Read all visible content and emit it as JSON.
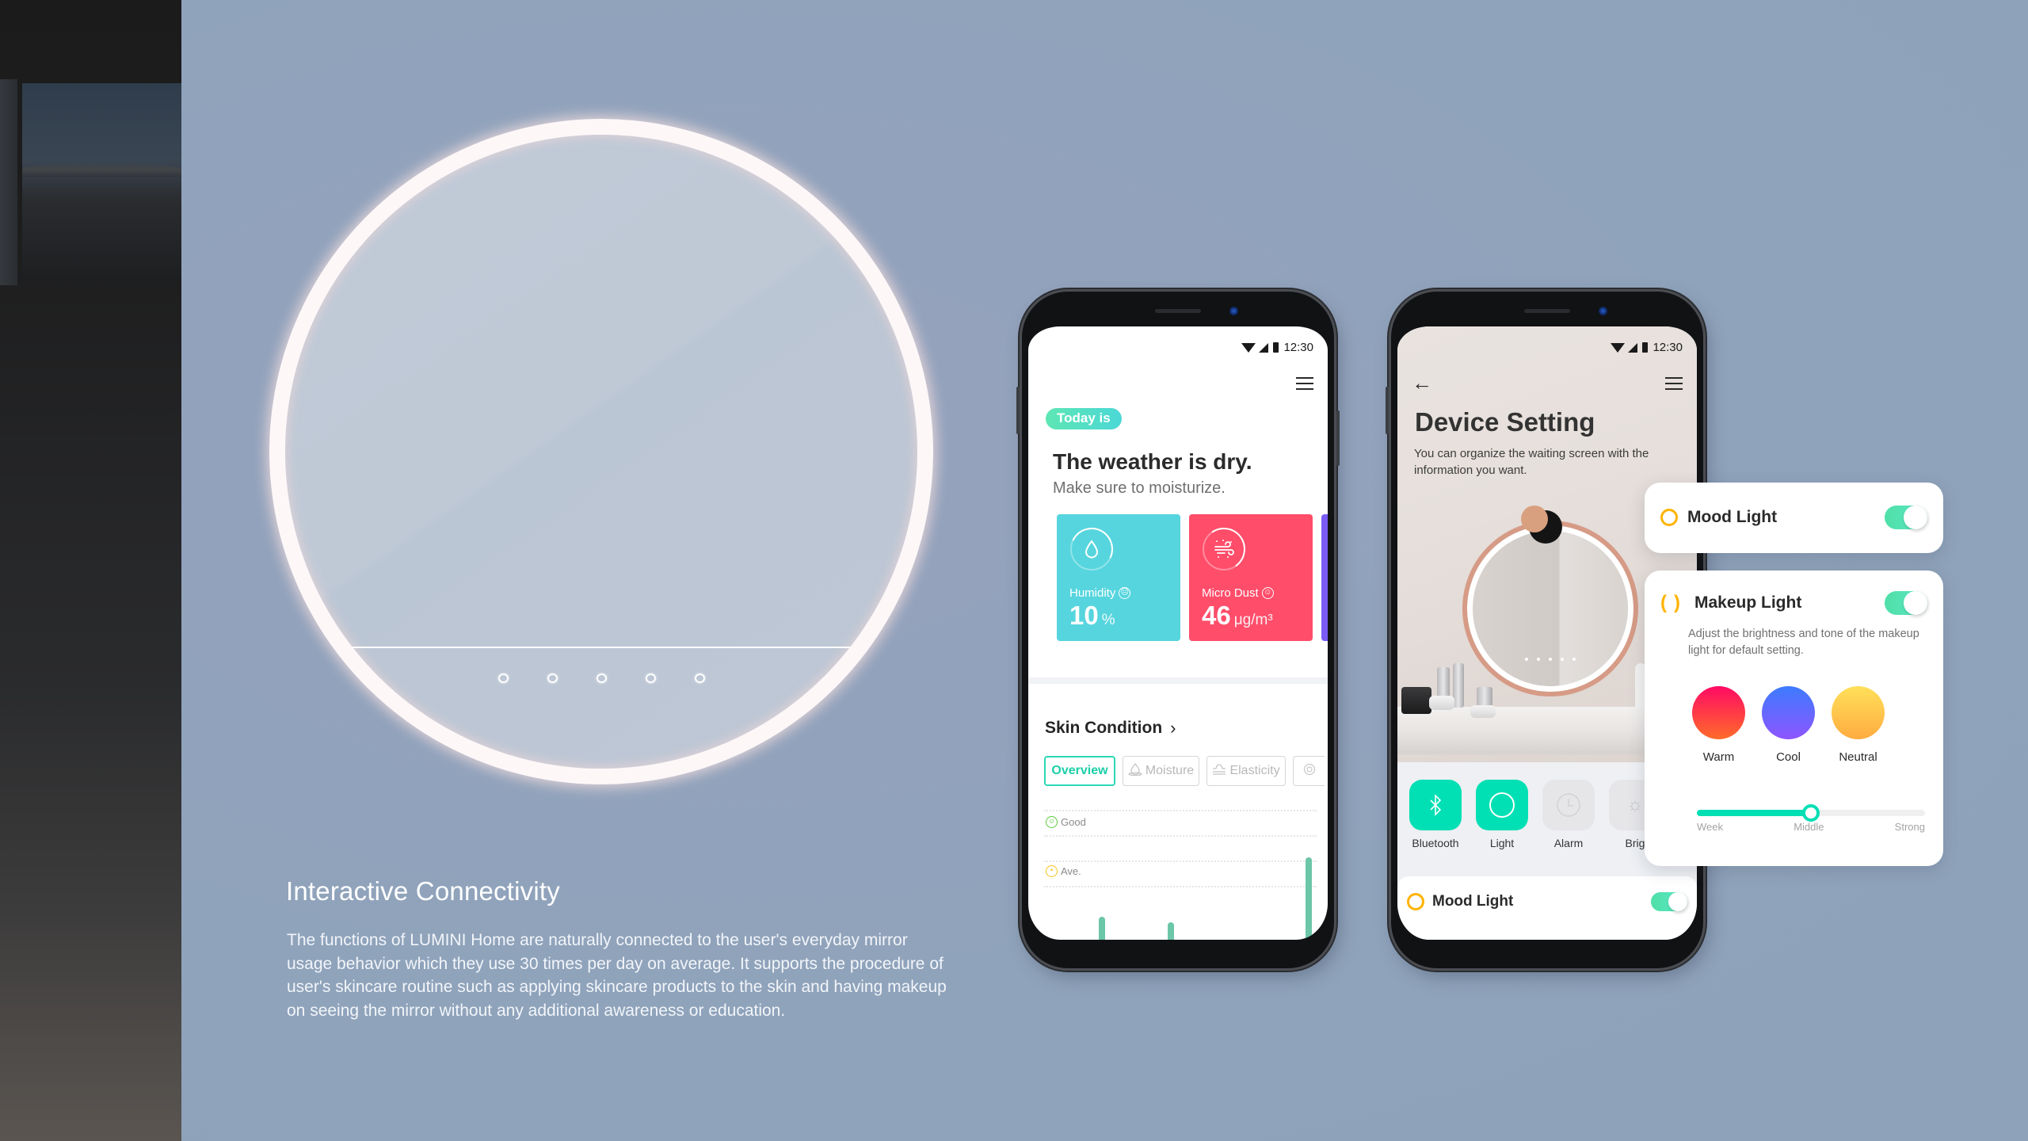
{
  "background": {
    "color": "#8fa3bb"
  },
  "intro": {
    "title": "Interactive Connectivity",
    "body": "The functions of LUMINI Home are naturally connected to the user's everyday mirror usage behavior which they use 30 times per day on average. It supports the procedure of user's skincare routine such as applying skincare products to the skin and having makeup on seeing the mirror without any additional awareness or education."
  },
  "mirror": {
    "touch_buttons": 5
  },
  "phone1": {
    "status": {
      "time": "12:30",
      "icons": [
        "wifi-icon",
        "signal-icon",
        "battery-icon"
      ]
    },
    "menu_icon": "menu-icon",
    "badge": "Today is",
    "title": "The weather is dry.",
    "subtitle": "Make sure to moisturize.",
    "tiles": [
      {
        "label": "Humidity",
        "face": "sad-face-icon",
        "value": "10",
        "unit": "%",
        "icon": "water-drop-icon",
        "color": "#56d5de"
      },
      {
        "label": "Micro Dust",
        "face": "happy-face-icon",
        "value": "46",
        "unit": "μg/m³",
        "icon": "wind-dust-icon",
        "color": "#ff4d6a"
      }
    ],
    "skin": {
      "title": "Skin Condition",
      "tabs": [
        {
          "label": "Overview",
          "active": true
        },
        {
          "label": "Moisture",
          "icon": "moisture-icon"
        },
        {
          "label": "Elasticity",
          "icon": "elasticity-icon"
        },
        {
          "label": "",
          "icon": "pore-icon"
        }
      ],
      "levels": [
        {
          "label": "Good",
          "color": "#5ccb3a"
        },
        {
          "label": "Ave.",
          "color": "#f5c518"
        }
      ]
    },
    "chart_data": {
      "type": "bar",
      "title": "Skin Condition",
      "ylabel": "",
      "xlabel": "",
      "levels": [
        "Ave.",
        "Good"
      ],
      "ylim": [
        0,
        1
      ],
      "values": [
        0.0,
        0.28,
        0.0,
        0.0,
        0.24,
        0.0,
        0.0,
        0.0,
        0.0,
        0.0,
        0.75
      ],
      "color": "#6cc6a8"
    }
  },
  "phone2": {
    "status": {
      "time": "12:30",
      "icons": [
        "wifi-icon",
        "signal-icon",
        "battery-icon"
      ]
    },
    "back_icon": "arrow-left-icon",
    "title": "Device Setting",
    "subtitle": "You can organize the waiting screen with the information you want.",
    "quick_actions": [
      {
        "label": "Bluetooth",
        "icon": "bluetooth-icon",
        "on": true
      },
      {
        "label": "Light",
        "icon": "light-ring-icon",
        "on": true
      },
      {
        "label": "Alarm",
        "icon": "clock-icon",
        "on": false
      },
      {
        "label": "Brig",
        "icon": "brightness-icon",
        "on": false
      }
    ],
    "mood_light": {
      "label": "Mood Light",
      "enabled": true
    }
  },
  "cards": {
    "mood": {
      "label": "Mood Light",
      "enabled": true
    },
    "makeup": {
      "label": "Makeup Light",
      "enabled": true,
      "description": "Adjust the brightness and tone of the makeup light for default setting.",
      "tones": [
        {
          "label": "Warm",
          "from": "#ff0a64",
          "to": "#ff6b2a"
        },
        {
          "label": "Cool",
          "from": "#3d7bff",
          "to": "#8e55ff"
        },
        {
          "label": "Neutral",
          "from": "#ffe05a",
          "to": "#ffac40"
        }
      ],
      "brightness": {
        "labels": [
          "Week",
          "Middle",
          "Strong"
        ],
        "value": 0.5
      }
    }
  },
  "accent": "#00dfb4",
  "ring_color": "#ffb300"
}
